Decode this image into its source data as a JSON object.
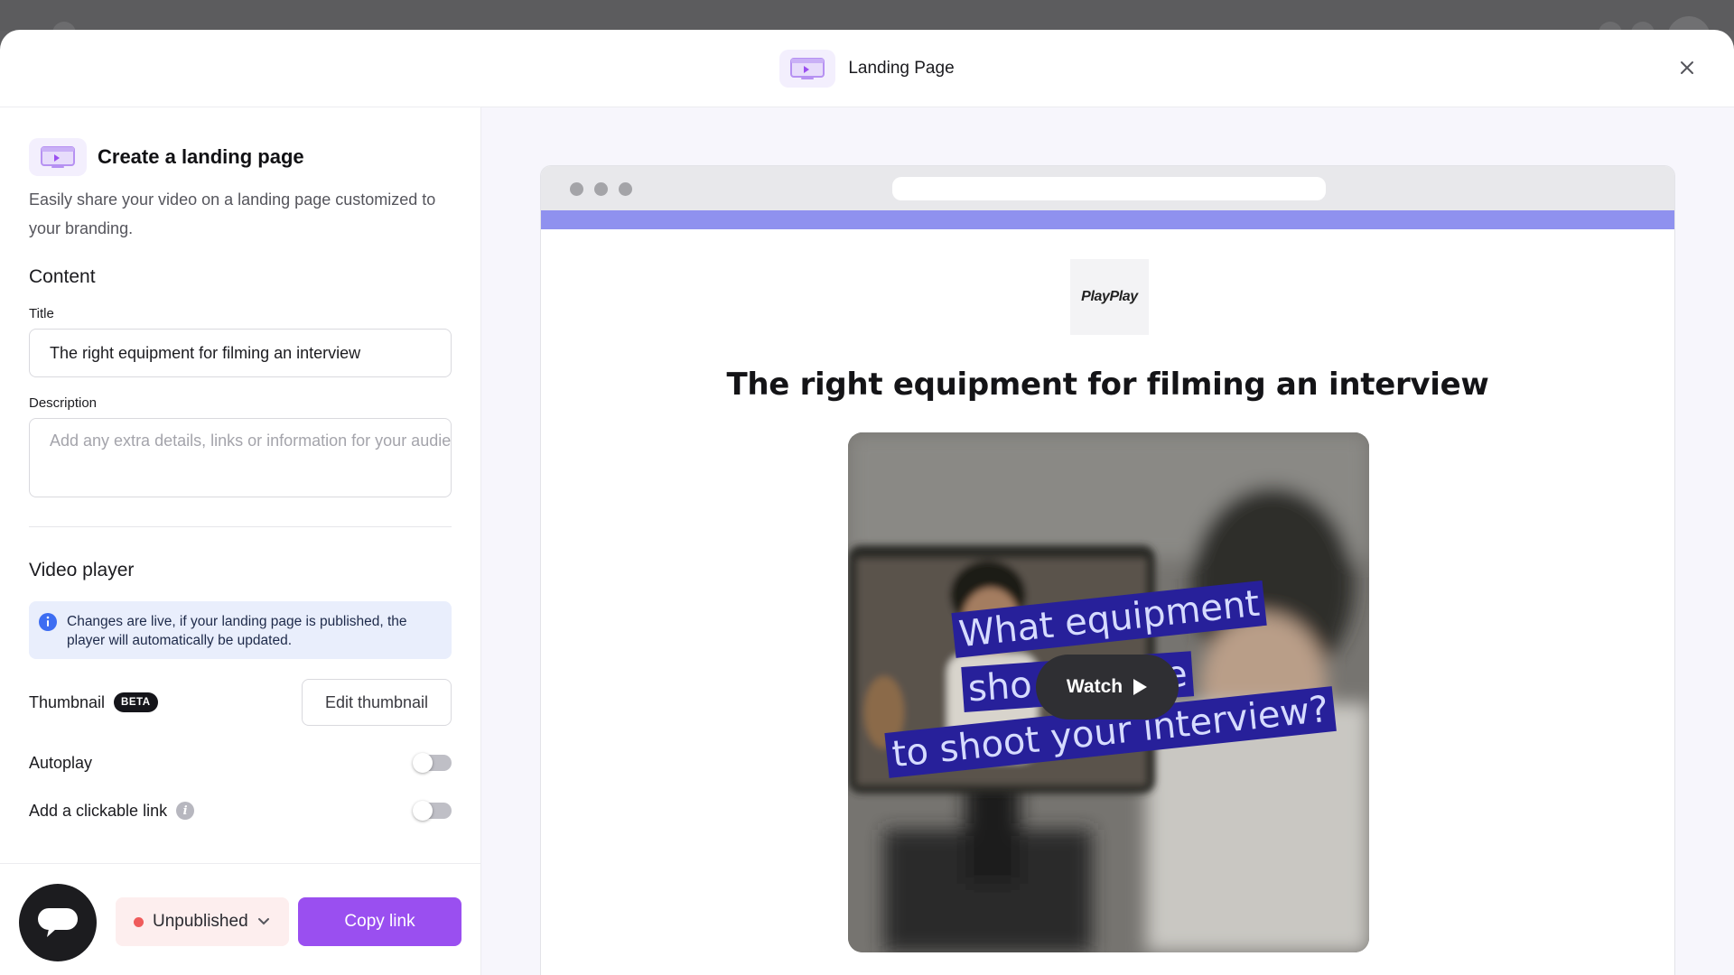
{
  "modal": {
    "title": "Landing Page"
  },
  "left": {
    "header": {
      "title": "Create a landing page",
      "description": "Easily share your video on a landing page customized to your branding."
    },
    "content": {
      "section_title": "Content",
      "title_label": "Title",
      "title_value": "The right equipment for filming an interview",
      "description_label": "Description",
      "description_placeholder": "Add any extra details, links or information for your audience"
    },
    "video_player": {
      "section_title": "Video player",
      "notice": "Changes are live, if your landing page is published, the player will automatically be updated.",
      "thumbnail_label": "Thumbnail",
      "beta_badge": "BETA",
      "edit_thumbnail_label": "Edit thumbnail",
      "autoplay_label": "Autoplay",
      "autoplay_on": false,
      "clickable_link_label": "Add a clickable link",
      "clickable_link_on": false
    },
    "footer": {
      "status_label": "Unpublished",
      "status_color": "#ef5b5b",
      "copy_link_label": "Copy link"
    }
  },
  "preview": {
    "logo_text": "PlayPlay",
    "brand_color": "#8f91ef",
    "page_title": "The right equipment for filming an interview",
    "video": {
      "caption_lines": [
        "What equipment",
        "sho        use",
        "to shoot your interview?"
      ],
      "watch_label": "Watch"
    }
  },
  "colors": {
    "accent": "#9a4ff0",
    "notice_bg": "#e9eefc",
    "info_blue": "#3d6df2"
  }
}
